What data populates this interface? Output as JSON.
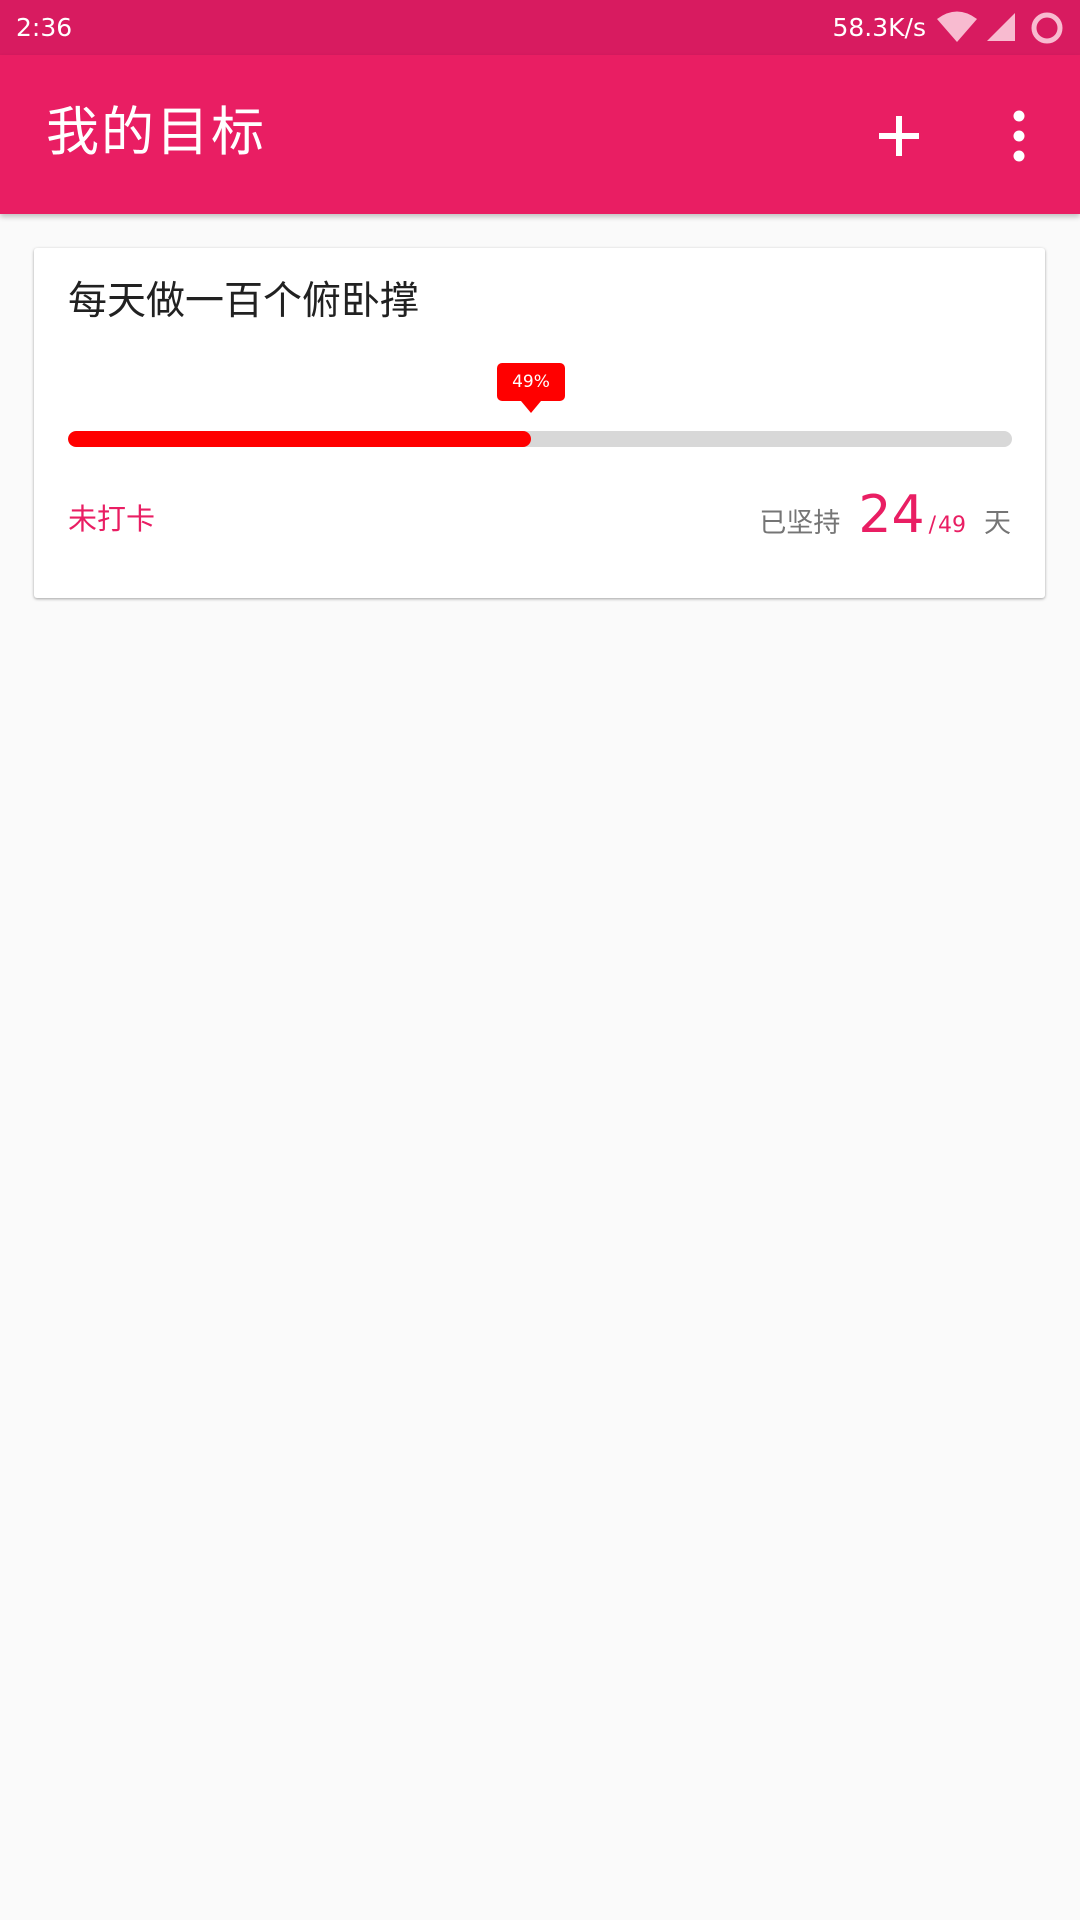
{
  "status_bar": {
    "time": "2:36",
    "network_speed": "58.3K/s",
    "icons": [
      "wifi-icon",
      "cell-signal-icon",
      "circle-icon"
    ]
  },
  "app_bar": {
    "title": "我的目标",
    "actions": [
      "add-icon",
      "more-vert-icon"
    ],
    "background_color": "#e91e63"
  },
  "goals": [
    {
      "title": "每天做一百个俯卧撑",
      "progress_label": "49%",
      "progress_fraction": 0.49,
      "checkin_status": "未打卡",
      "streak_label": "已坚持",
      "streak_days": "24",
      "separator": "/",
      "total_days": "49",
      "unit": "天"
    }
  ],
  "colors": {
    "status_bar": "#d81b60",
    "accent": "#e91e63",
    "progress_fill": "#ff0000",
    "progress_track": "#d8d8d8"
  }
}
